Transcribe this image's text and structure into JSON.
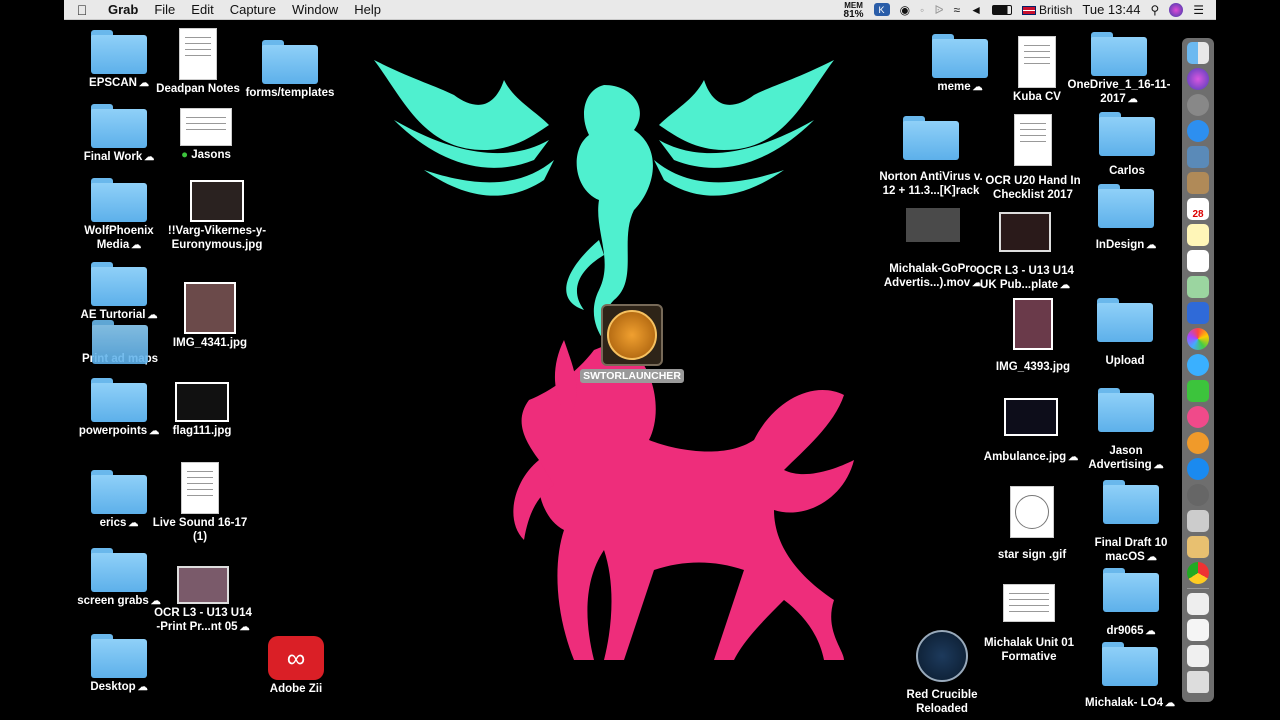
{
  "menubar": {
    "app": "Grab",
    "menus": [
      "File",
      "Edit",
      "Capture",
      "Window",
      "Help"
    ],
    "mem_label": "MEM",
    "mem_value": "81%",
    "keyboard": "British",
    "clock": "Tue 13:44"
  },
  "left_items": [
    {
      "label": "EPSCAN",
      "cloud": true
    },
    {
      "label": "Deadpan Notes",
      "cloud": false
    },
    {
      "label": "forms/templates",
      "cloud": false
    },
    {
      "label": "Final Work",
      "cloud": true
    },
    {
      "label": "Jasons",
      "cloud": false
    },
    {
      "label": "WolfPhoenix\nMedia",
      "cloud": true
    },
    {
      "label": "!!Varg-Vikernes-y-\nEuronymous.jpg",
      "cloud": false
    },
    {
      "label": "AE Turtorial",
      "cloud": true
    },
    {
      "label": "IMG_4341.jpg",
      "cloud": false
    },
    {
      "label": "Print ad maps",
      "cloud": false
    },
    {
      "label": "powerpoints",
      "cloud": true
    },
    {
      "label": "flag111.jpg",
      "cloud": false
    },
    {
      "label": "erics",
      "cloud": true
    },
    {
      "label": "Live Sound 16-17\n(1)",
      "cloud": false
    },
    {
      "label": "screen grabs",
      "cloud": true
    },
    {
      "label": "OCR L3 - U13  U14\n-Print Pr...nt 05",
      "cloud": true
    },
    {
      "label": "Desktop",
      "cloud": true
    },
    {
      "label": "Adobe Zii",
      "cloud": false
    }
  ],
  "center_item": {
    "label": "SWTORLAUNCHER"
  },
  "right_items": [
    {
      "label": "meme",
      "cloud": true
    },
    {
      "label": "Kuba CV",
      "cloud": false
    },
    {
      "label": "OneDrive_1_16-11-\n2017",
      "cloud": true
    },
    {
      "label": "Norton AntiVirus v.\n12 + 11.3...[K]rack",
      "cloud": false
    },
    {
      "label": "OCR U20 Hand In\nChecklist 2017",
      "cloud": false
    },
    {
      "label": "Carlos",
      "cloud": false
    },
    {
      "label": "InDesign",
      "cloud": true
    },
    {
      "label": "Michalak-GoPro\nAdvertis...).mov",
      "cloud": true
    },
    {
      "label": "OCR L3 - U13  U14\nUK Pub...plate",
      "cloud": true
    },
    {
      "label": "IMG_4393.jpg",
      "cloud": false
    },
    {
      "label": "Upload",
      "cloud": false
    },
    {
      "label": "Ambulance.jpg",
      "cloud": true
    },
    {
      "label": "Jason\nAdvertising",
      "cloud": true
    },
    {
      "label": "star sign .gif",
      "cloud": false
    },
    {
      "label": "Final Draft 10\nmacOS",
      "cloud": true
    },
    {
      "label": "dr9065",
      "cloud": true
    },
    {
      "label": "Michalak Unit 01\nFormative",
      "cloud": false
    },
    {
      "label": "Red Crucible\nReloaded",
      "cloud": false
    },
    {
      "label": "Michalak- LO4",
      "cloud": true
    }
  ],
  "dock_count": 25,
  "dock_badge_calendar": "28"
}
